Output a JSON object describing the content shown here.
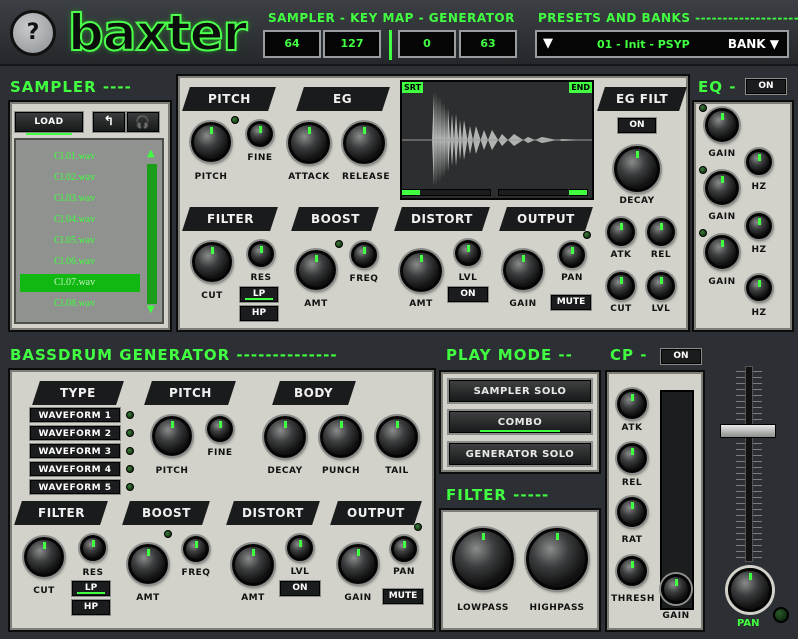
{
  "header": {
    "help_label": "?",
    "logo": "baxter",
    "sampler_title": "SAMPLER -  KEY MAP - GENERATOR",
    "keymap_values": [
      "64",
      "127",
      "0",
      "63"
    ],
    "presets_title": "PRESETS AND BANKS ----------------------",
    "preset_arrow": "▼",
    "preset_name": "01 - Init - PSYP",
    "bank_label": "BANK ▼"
  },
  "sampler": {
    "title": "SAMPLER ----",
    "load_label": "LOAD",
    "files": [
      "Cl.01.wav",
      "Cl.02.wav",
      "Cl.03.wav",
      "Cl.04.wav",
      "Cl.05.wav",
      "Cl.06.wav",
      "Cl.07.wav",
      "Cl.08.wav"
    ],
    "selected_index": 6,
    "up_arrow": "▲",
    "down_arrow": "▼",
    "tabs": {
      "pitch": "PITCH",
      "eg": "EG",
      "egfilt": "EG FILT",
      "filter": "FILTER",
      "boost": "BOOST",
      "distort": "DISTORT",
      "output": "OUTPUT"
    },
    "labels": {
      "pitch": "PITCH",
      "fine": "FINE",
      "attack": "ATTACK",
      "release": "RELEASE",
      "decay": "DECAY",
      "on": "ON",
      "cut": "CUT",
      "res": "RES",
      "lp": "LP",
      "hp": "HP",
      "amt": "AMT",
      "freq": "FREQ",
      "lvl": "LVL",
      "gain": "GAIN",
      "pan": "PAN",
      "mute": "MUTE",
      "atk": "ATK",
      "rel": "REL"
    },
    "wave": {
      "start": "SRT",
      "end": "END"
    }
  },
  "eq": {
    "title": "EQ -",
    "on": "ON",
    "gain": "GAIN",
    "hz": "HZ"
  },
  "generator": {
    "title": "BASSDRUM GENERATOR --------------",
    "tabs": {
      "type": "TYPE",
      "pitch": "PITCH",
      "body": "BODY",
      "filter": "FILTER",
      "boost": "BOOST",
      "distort": "DISTORT",
      "output": "OUTPUT"
    },
    "waveforms": [
      "WAVEFORM 1",
      "WAVEFORM 2",
      "WAVEFORM 3",
      "WAVEFORM 4",
      "WAVEFORM 5"
    ],
    "labels": {
      "pitch": "PITCH",
      "fine": "FINE",
      "decay": "DECAY",
      "punch": "PUNCH",
      "tail": "TAIL",
      "cut": "CUT",
      "res": "RES",
      "lp": "LP",
      "hp": "HP",
      "amt": "AMT",
      "freq": "FREQ",
      "lvl": "LVL",
      "on": "ON",
      "gain": "GAIN",
      "pan": "PAN",
      "mute": "MUTE"
    }
  },
  "playmode": {
    "title": "PLAY MODE --",
    "options": [
      "SAMPLER SOLO",
      "COMBO",
      "GENERATOR SOLO"
    ],
    "selected": "COMBO"
  },
  "filter": {
    "title": "FILTER -----",
    "lowpass": "LOWPASS",
    "highpass": "HIGHPASS"
  },
  "cp": {
    "title": "CP -",
    "on": "ON",
    "atk": "ATK",
    "rel": "REL",
    "rat": "RAT",
    "thresh": "THRESH",
    "gain": "GAIN"
  },
  "master": {
    "pan": "PAN"
  },
  "colors": {
    "accent": "#41ff41",
    "panel": "#d2d2ca",
    "bg": "#2c2f33"
  }
}
